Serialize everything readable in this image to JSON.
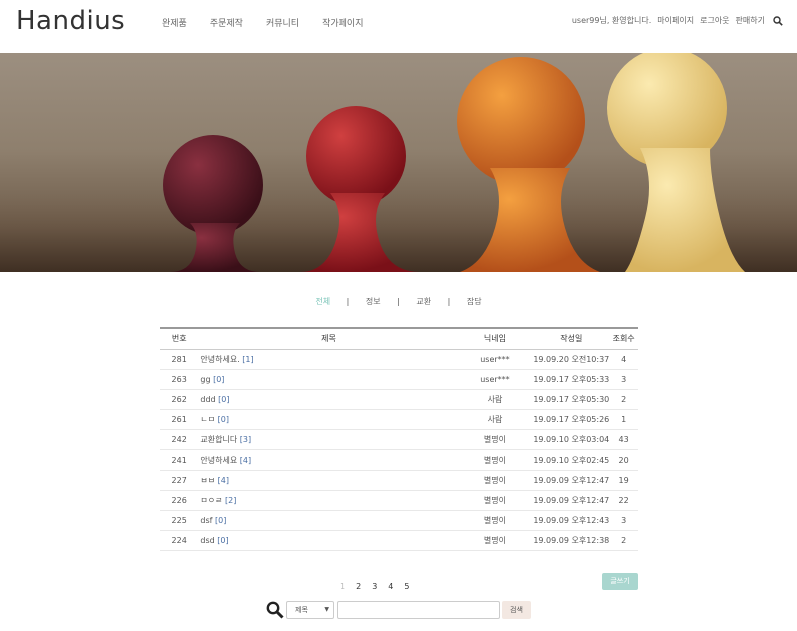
{
  "header": {
    "logo": "Handius",
    "nav": [
      "완제품",
      "주문제작",
      "커뮤니티",
      "작가페이지"
    ],
    "greeting": "user99님, 환영합니다.",
    "links": [
      "마이페이지",
      "로그아웃",
      "판매하기"
    ]
  },
  "categories": {
    "items": [
      "전체",
      "정보",
      "교환",
      "잡담"
    ],
    "active": "전체"
  },
  "table": {
    "headers": [
      "번호",
      "제목",
      "닉네임",
      "작성일",
      "조회수"
    ],
    "rows": [
      {
        "no": "281",
        "title": "안녕하세요.",
        "comments": "[1]",
        "nick": "user***",
        "date": "19.09.20 오전10:37",
        "views": "4"
      },
      {
        "no": "263",
        "title": "gg",
        "comments": "[0]",
        "nick": "user***",
        "date": "19.09.17 오후05:33",
        "views": "3"
      },
      {
        "no": "262",
        "title": "ddd",
        "comments": "[0]",
        "nick": "사람",
        "date": "19.09.17 오후05:30",
        "views": "2"
      },
      {
        "no": "261",
        "title": "ㄴㅁ",
        "comments": "[0]",
        "nick": "사람",
        "date": "19.09.17 오후05:26",
        "views": "1"
      },
      {
        "no": "242",
        "title": "교환합니다",
        "comments": "[3]",
        "nick": "별명이",
        "date": "19.09.10 오후03:04",
        "views": "43"
      },
      {
        "no": "241",
        "title": "안녕하세요",
        "comments": "[4]",
        "nick": "별명이",
        "date": "19.09.10 오후02:45",
        "views": "20"
      },
      {
        "no": "227",
        "title": "ㅂㅂ",
        "comments": "[4]",
        "nick": "별명이",
        "date": "19.09.09 오후12:47",
        "views": "19"
      },
      {
        "no": "226",
        "title": "ㅁㅇㄹ",
        "comments": "[2]",
        "nick": "별명이",
        "date": "19.09.09 오후12:47",
        "views": "22"
      },
      {
        "no": "225",
        "title": "dsf",
        "comments": "[0]",
        "nick": "별명이",
        "date": "19.09.09 오후12:43",
        "views": "3"
      },
      {
        "no": "224",
        "title": "dsd",
        "comments": "[0]",
        "nick": "별명이",
        "date": "19.09.09 오후12:38",
        "views": "2"
      }
    ]
  },
  "paging": {
    "pages": [
      "1",
      "2",
      "3",
      "4",
      "5"
    ],
    "current": "1"
  },
  "write_button": "글쓰기",
  "search": {
    "select_value": "제목",
    "button": "검색"
  }
}
